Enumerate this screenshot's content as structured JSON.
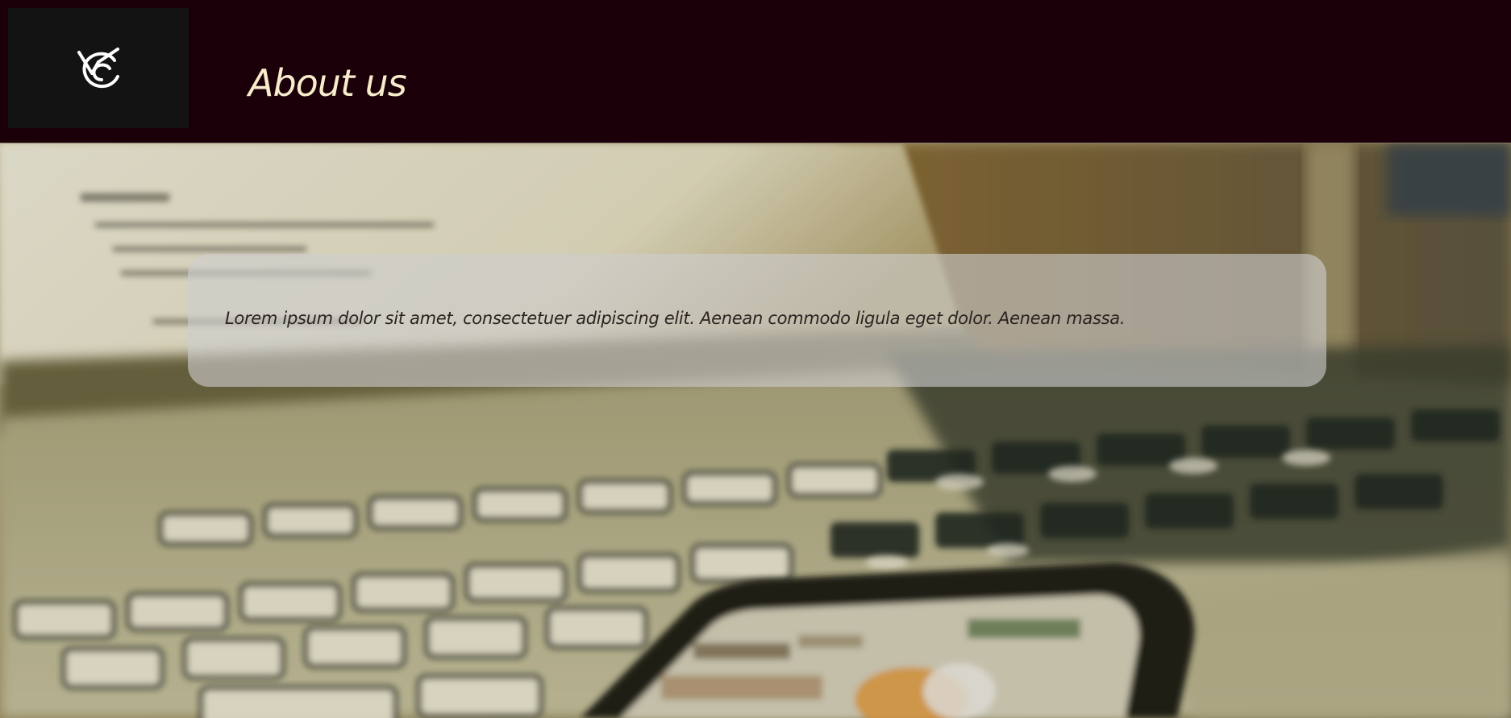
{
  "header": {
    "logo": {
      "icon": "vc-monogram-logo-icon",
      "color": "#ffffff",
      "background": "#131313"
    },
    "title": "About us",
    "background": "#1b0009",
    "title_color": "#f7eccb"
  },
  "hero": {
    "background_image": "blurred-laptop-and-smartphone-photo",
    "card": {
      "text": "Lorem ipsum dolor sit amet, consectetuer adipiscing elit. Aenean commodo ligula eget dolor. Aenean massa."
    }
  }
}
